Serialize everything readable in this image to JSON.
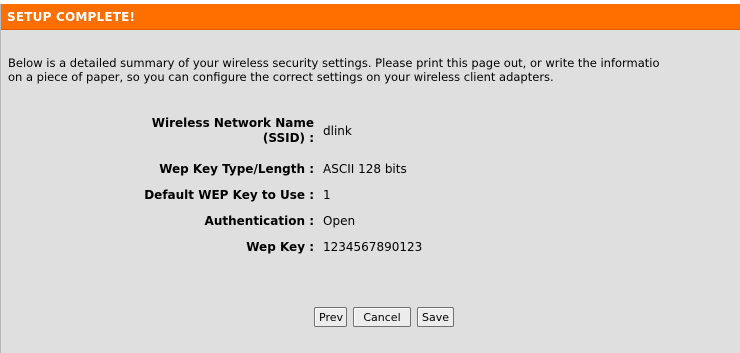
{
  "header": {
    "title": "SETUP COMPLETE!"
  },
  "description": {
    "line1": "Below is a detailed summary of your wireless security settings. Please print this page out, or write the informatio",
    "line2": "on a piece of paper, so you can configure the correct settings on your wireless client adapters."
  },
  "summary": {
    "ssid": {
      "label_line1": "Wireless Network Name",
      "label_line2": "(SSID) :",
      "value": "dlink"
    },
    "wep_key_type": {
      "label": "Wep Key Type/Length :",
      "value": "ASCII 128 bits"
    },
    "default_wep_key": {
      "label": "Default WEP Key to Use :",
      "value": "1"
    },
    "authentication": {
      "label": "Authentication :",
      "value": "Open"
    },
    "wep_key": {
      "label": "Wep Key :",
      "value": "1234567890123"
    }
  },
  "buttons": {
    "prev": "Prev",
    "cancel": "Cancel",
    "save": "Save"
  },
  "colors": {
    "title_bar": "#ff6f00",
    "panel_background": "#dfdfdf"
  }
}
